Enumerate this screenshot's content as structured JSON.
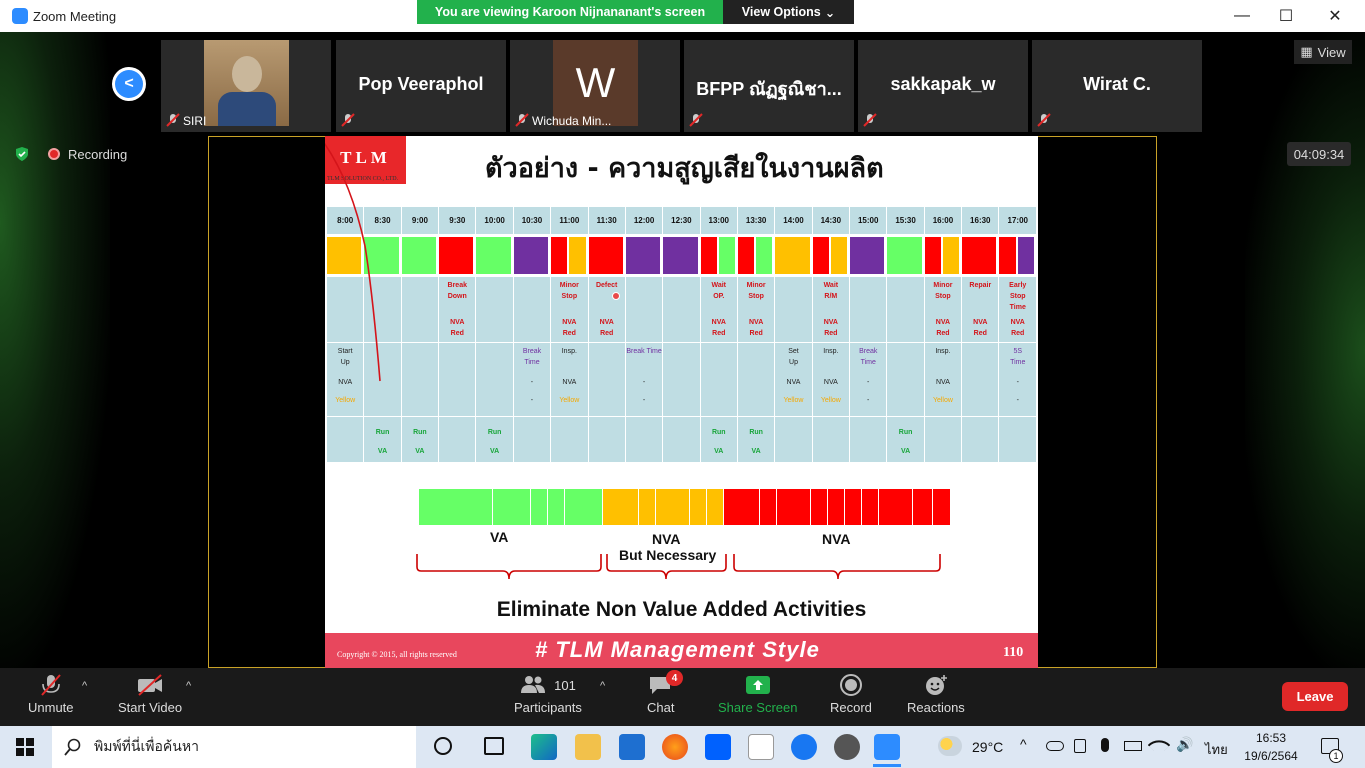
{
  "window": {
    "title": "Zoom Meeting",
    "minimize": "—",
    "maximize": "☐",
    "close": "✕"
  },
  "banner": {
    "text": "You are viewing Karoon Nijnananant's screen",
    "view_options": "View Options"
  },
  "view_button": "View",
  "recording": "Recording",
  "timer": "04:09:34",
  "participants_strip": [
    {
      "name": "",
      "sub": "SIRI"
    },
    {
      "name": "Pop Veeraphol",
      "sub": ""
    },
    {
      "name": "W",
      "sub": "Wichuda Min..."
    },
    {
      "name": "BFPP ณัฏฐณิชา...",
      "sub": ""
    },
    {
      "name": "sakkapak_w",
      "sub": ""
    },
    {
      "name": "Wirat C.",
      "sub": ""
    }
  ],
  "slide": {
    "logo": "TLM",
    "logo_sub": "TLM SOLUTION CO., LTD.",
    "title": "ตัวอย่าง - ความสูญเสียในงานผลิต",
    "times": [
      "8:00",
      "8:30",
      "9:00",
      "9:30",
      "10:00",
      "10:30",
      "11:00",
      "11:30",
      "12:00",
      "12:30",
      "13:00",
      "13:30",
      "14:00",
      "14:30",
      "15:00",
      "15:30",
      "16:00",
      "16:30",
      "17:00"
    ],
    "row_red": [
      [],
      [],
      [],
      [
        "Break",
        "Down",
        "",
        "NVA",
        "Red"
      ],
      [],
      [],
      [
        "Minor",
        "Stop",
        "",
        "NVA",
        "Red"
      ],
      [
        "Defect",
        "",
        "",
        "NVA",
        "Red"
      ],
      [],
      [],
      [
        "Wait",
        "OP.",
        "",
        "NVA",
        "Red"
      ],
      [
        "Minor",
        "Stop",
        "",
        "NVA",
        "Red"
      ],
      [],
      [
        "Wait",
        "R/M",
        "",
        "NVA",
        "Red"
      ],
      [],
      [],
      [
        "Minor",
        "Stop",
        "",
        "NVA",
        "Red"
      ],
      [
        "Repair",
        "",
        "",
        "NVA",
        "Red"
      ],
      [
        "Early",
        "Stop",
        "Time",
        "NVA",
        "Red"
      ]
    ],
    "row_yellow": [
      [
        "Start",
        "Up",
        "NVA",
        "Yellow"
      ],
      [],
      [],
      [],
      [],
      [
        "Break",
        "Time",
        "-",
        "-"
      ],
      [
        "Insp.",
        "",
        "NVA",
        "Yellow"
      ],
      [],
      [
        "Break Time",
        "",
        "-",
        "-"
      ],
      [],
      [],
      [],
      [
        "Set",
        "Up",
        "NVA",
        "Yellow"
      ],
      [
        "Insp.",
        "",
        "NVA",
        "Yellow"
      ],
      [
        "Break",
        "Time",
        "-",
        "-"
      ],
      [],
      [
        "Insp.",
        "",
        "NVA",
        "Yellow"
      ],
      [],
      [
        "5S",
        "Time",
        "-",
        "-"
      ]
    ],
    "row_green": [
      [],
      [
        "Run",
        "VA"
      ],
      [
        "Run",
        "VA"
      ],
      [],
      [
        "Run",
        "VA"
      ],
      [],
      [],
      [],
      [],
      [],
      [
        "Run",
        "VA"
      ],
      [
        "Run",
        "VA"
      ],
      [],
      [],
      [],
      [
        "Run",
        "VA"
      ],
      [],
      [],
      []
    ],
    "labels": {
      "va": "VA",
      "nva_nec_1": "NVA",
      "nva_nec_2": "But Necessary",
      "nva": "NVA"
    },
    "eliminate": "Eliminate Non Value Added Activities",
    "copyright": "Copyright © 2015, all rights reserved",
    "management": "# TLM Management Style",
    "page": "110"
  },
  "toolbar": {
    "unmute": "Unmute",
    "start_video": "Start Video",
    "participants_count": "101",
    "participants": "Participants",
    "chat": "Chat",
    "chat_badge": "4",
    "share": "Share Screen",
    "record": "Record",
    "reactions": "Reactions",
    "leave": "Leave"
  },
  "taskbar": {
    "search_placeholder": "พิมพ์ที่นี่เพื่อค้นหา",
    "weather": "29°C",
    "lang": "ไทย",
    "time": "16:53",
    "date": "19/6/2564",
    "notif": "1"
  },
  "colors": {
    "green": "#66ff66",
    "yellow": "#ffc000",
    "red": "#ff0000",
    "purple": "#7030a0",
    "zoom_blue": "#2d8cff",
    "share_green": "#22b14c"
  }
}
